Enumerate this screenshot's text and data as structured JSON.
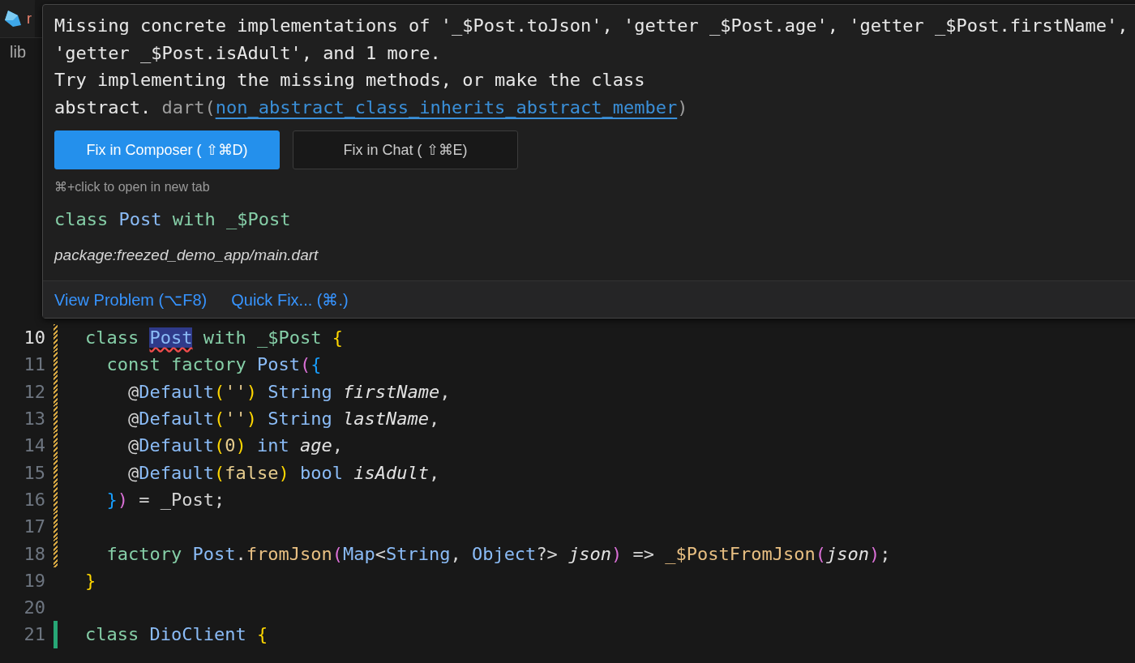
{
  "tab": {
    "label": "r",
    "error": true
  },
  "breadcrumb": {
    "label": "lib"
  },
  "editor": {
    "lines": [
      {
        "number": "10",
        "modified": true,
        "added": false,
        "current": true,
        "tokens": [
          {
            "text": "class ",
            "kind": "kw"
          },
          {
            "text": "Post",
            "kind": "error"
          },
          {
            "text": " with _$Post ",
            "kind": "kw"
          },
          {
            "text": "{",
            "kind": "b1"
          }
        ]
      },
      {
        "number": "11",
        "modified": true,
        "added": false,
        "current": false,
        "tokens": [
          {
            "text": "  const factory ",
            "kind": "kw"
          },
          {
            "text": "Post",
            "kind": "type"
          },
          {
            "text": "(",
            "kind": "b2"
          },
          {
            "text": "{",
            "kind": "b3"
          }
        ]
      },
      {
        "number": "12",
        "modified": true,
        "added": false,
        "current": false,
        "tokens": [
          {
            "text": "    @",
            "kind": "plain"
          },
          {
            "text": "Default",
            "kind": "type"
          },
          {
            "text": "(",
            "kind": "b1"
          },
          {
            "text": "''",
            "kind": "lit"
          },
          {
            "text": ")",
            "kind": "b1"
          },
          {
            "text": " String ",
            "kind": "type"
          },
          {
            "text": "firstName",
            "kind": "param"
          },
          {
            "text": ",",
            "kind": "plain"
          }
        ]
      },
      {
        "number": "13",
        "modified": true,
        "added": false,
        "current": false,
        "tokens": [
          {
            "text": "    @",
            "kind": "plain"
          },
          {
            "text": "Default",
            "kind": "type"
          },
          {
            "text": "(",
            "kind": "b1"
          },
          {
            "text": "''",
            "kind": "lit"
          },
          {
            "text": ")",
            "kind": "b1"
          },
          {
            "text": " String ",
            "kind": "type"
          },
          {
            "text": "lastName",
            "kind": "param"
          },
          {
            "text": ",",
            "kind": "plain"
          }
        ]
      },
      {
        "number": "14",
        "modified": true,
        "added": false,
        "current": false,
        "tokens": [
          {
            "text": "    @",
            "kind": "plain"
          },
          {
            "text": "Default",
            "kind": "type"
          },
          {
            "text": "(",
            "kind": "b1"
          },
          {
            "text": "0",
            "kind": "lit"
          },
          {
            "text": ")",
            "kind": "b1"
          },
          {
            "text": " int ",
            "kind": "type"
          },
          {
            "text": "age",
            "kind": "param"
          },
          {
            "text": ",",
            "kind": "plain"
          }
        ]
      },
      {
        "number": "15",
        "modified": true,
        "added": false,
        "current": false,
        "tokens": [
          {
            "text": "    @",
            "kind": "plain"
          },
          {
            "text": "Default",
            "kind": "type"
          },
          {
            "text": "(",
            "kind": "b1"
          },
          {
            "text": "false",
            "kind": "lit"
          },
          {
            "text": ")",
            "kind": "b1"
          },
          {
            "text": " bool ",
            "kind": "type"
          },
          {
            "text": "isAdult",
            "kind": "param"
          },
          {
            "text": ",",
            "kind": "plain"
          }
        ]
      },
      {
        "number": "16",
        "modified": true,
        "added": false,
        "current": false,
        "tokens": [
          {
            "text": "  }",
            "kind": "b3"
          },
          {
            "text": ")",
            "kind": "b2"
          },
          {
            "text": " = _Post;",
            "kind": "plain"
          }
        ]
      },
      {
        "number": "17",
        "modified": true,
        "added": false,
        "current": false
      },
      {
        "number": "18",
        "modified": true,
        "added": false,
        "current": false,
        "tokens": [
          {
            "text": "  factory ",
            "kind": "kw"
          },
          {
            "text": "Post",
            "kind": "type"
          },
          {
            "text": ".",
            "kind": "plain"
          },
          {
            "text": "fromJson",
            "kind": "fn"
          },
          {
            "text": "(",
            "kind": "b2"
          },
          {
            "text": "Map",
            "kind": "type"
          },
          {
            "text": "<",
            "kind": "plain"
          },
          {
            "text": "String",
            "kind": "type"
          },
          {
            "text": ", ",
            "kind": "plain"
          },
          {
            "text": "Object",
            "kind": "type"
          },
          {
            "text": "?> ",
            "kind": "plain"
          },
          {
            "text": "json",
            "kind": "param"
          },
          {
            "text": ")",
            "kind": "b2"
          },
          {
            "text": " => ",
            "kind": "plain"
          },
          {
            "text": "_$PostFromJson",
            "kind": "fn"
          },
          {
            "text": "(",
            "kind": "b2"
          },
          {
            "text": "json",
            "kind": "param"
          },
          {
            "text": ")",
            "kind": "b2"
          },
          {
            "text": ";",
            "kind": "plain"
          }
        ]
      },
      {
        "number": "19",
        "modified": false,
        "added": false,
        "current": false,
        "tokens": [
          {
            "text": "}",
            "kind": "b1"
          }
        ]
      },
      {
        "number": "20",
        "modified": false,
        "added": false,
        "current": false
      },
      {
        "number": "21",
        "modified": false,
        "added": true,
        "current": false,
        "tokens": [
          {
            "text": "class ",
            "kind": "kw"
          },
          {
            "text": "DioClient ",
            "kind": "type"
          },
          {
            "text": "{",
            "kind": "b1"
          }
        ]
      }
    ]
  },
  "hover": {
    "message_lines": [
      "Missing concrete implementations of '_$Post.toJson', 'getter _$Post.age', 'getter _$Post.firstName',",
      "'getter _$Post.isAdult', and 1 more.",
      "Try implementing the missing methods, or make the class"
    ],
    "last_line": {
      "text": "abstract.",
      "source_open": "dart(",
      "code_link": "non_abstract_class_inherits_abstract_member",
      "source_close": ")"
    },
    "buttons": [
      {
        "label": "Fix in Composer ( ⇧⌘D)",
        "kind": "primary"
      },
      {
        "label": "Fix in Chat ( ⇧⌘E)",
        "kind": "secondary"
      }
    ],
    "hint": "⌘+click to open in new tab",
    "declaration": [
      {
        "text": "class ",
        "kind": "kw"
      },
      {
        "text": "Post",
        "kind": "type"
      },
      {
        "text": " with _$Post",
        "kind": "kw"
      }
    ],
    "location": "package:freezed_demo_app/main.dart",
    "actions": [
      "View Problem (⌥F8)",
      "Quick Fix... (⌘.)"
    ]
  }
}
